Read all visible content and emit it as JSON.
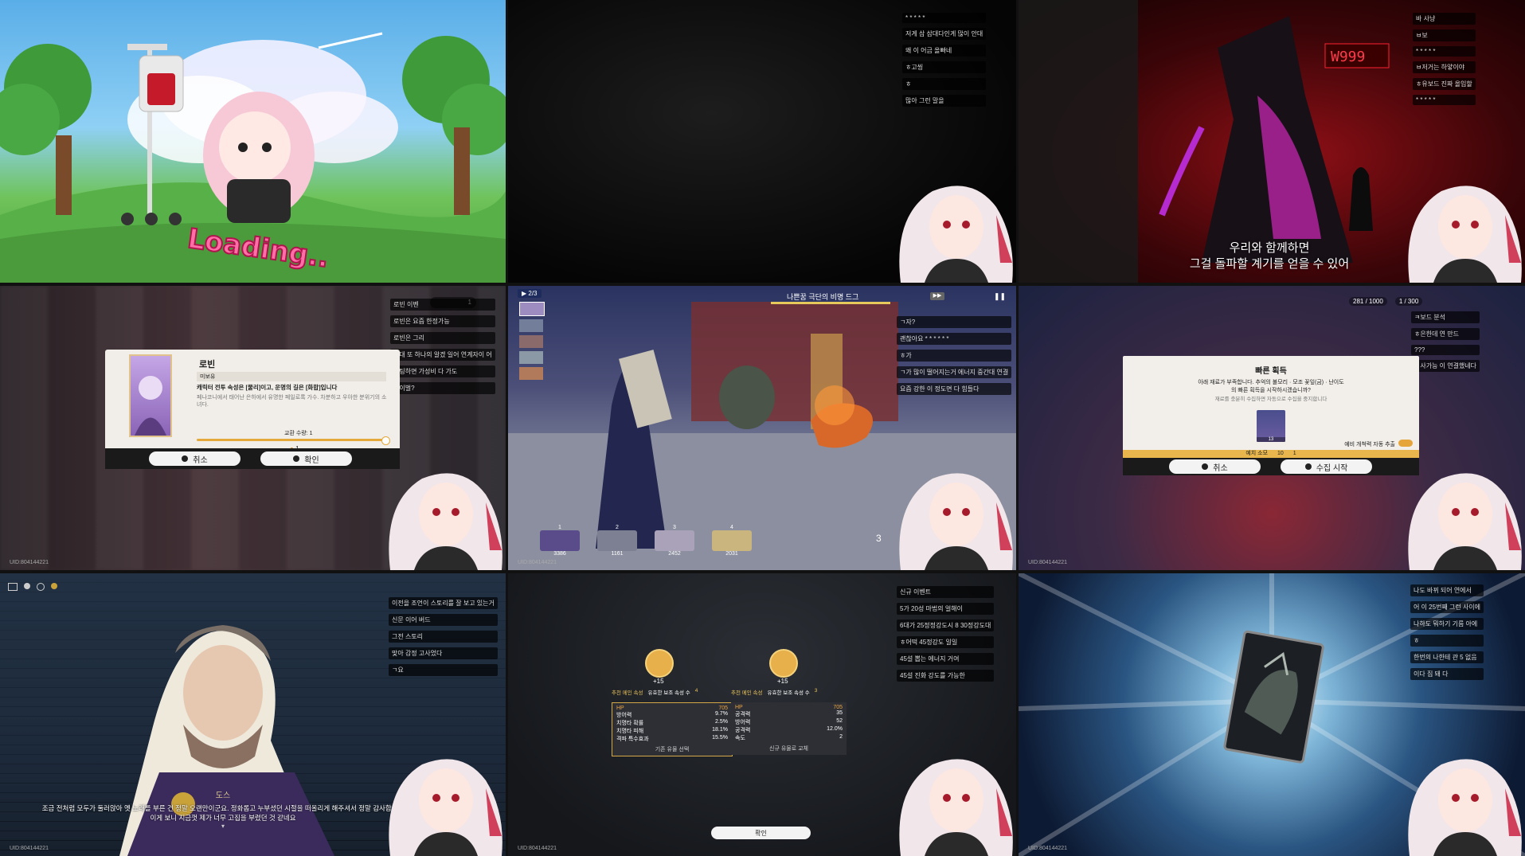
{
  "uid": "UID:804144221",
  "p1": {
    "loading": "Loading.."
  },
  "p2": {
    "chat": [
      "* * * * *",
      "저게 삼 삼대다인게 많이 안대",
      "왜 이 어금 올빠네",
      "ㅎ고씽",
      "ㅎ",
      "많아 그런 말을"
    ]
  },
  "p3": {
    "chat": [
      "바 사냥",
      "ㅂ보",
      "* * * * *",
      "ㅂ저거는 하얗이야",
      "ㅎ유보드 진짜 올입할",
      "* * * * *"
    ],
    "subtitle1": "우리와 함께하면",
    "subtitle2": "그걸 돌파할 계기를 얻을 수 있어",
    "counter": "W999"
  },
  "p4": {
    "chat": [
      "로빈 이벤",
      "로빈은 요즘 한정가능",
      "로빈은 그리",
      "그대 또 하나의 알겠 일어 연계자이 어",
      "셋팅하면 가성비 다 가도",
      "라이벌?"
    ],
    "name": "로빈",
    "tag": "미보유",
    "desc1": "캐릭터 전투 속성은 [물리]이고, 운명의 길은 [화합]입니다",
    "desc2": "페나코니에서 태어난 은하에서 유명한 페일로록 가수. 차분하고 우아한 분위기의 소녀다.",
    "exchange": "교환 수량: 1",
    "count": "1",
    "cancel": "취소",
    "confirm": "확인",
    "top_count": "1"
  },
  "p5": {
    "wave": "2/3",
    "boss": "나쁜꿈 극단의 비명 드그",
    "chat": [
      "ㄱ자?",
      "괜찮아요 * * * * * *",
      "ㅎ가",
      "ㄱ가 많이 떨어지는거 에너지 중간대 연결",
      "요즘 강한 이 정도면 다 힘들다"
    ],
    "hp": [
      "3386",
      "1161",
      "2452",
      "2031"
    ],
    "slots": [
      "1",
      "2",
      "3",
      "4"
    ],
    "wave_counter": "3"
  },
  "p6": {
    "currency1": "281 / 1000",
    "currency2": "1 / 300",
    "chat": [
      "ㅋ보드 분석",
      "ㅎ은한데 연 만드",
      "???",
      "ㅋ사가능 이 연결했네다"
    ],
    "title": "빠른 획득",
    "line1": "아래 재료가 부족합니다. 추억의 불모리 · 모조 꽃잎(금) · 난이도",
    "line2": "의 빠른 획득을 시작하시겠습니까?",
    "line3": "재료를 충분히 수집하면 자동으로 수집을 중지합니다",
    "item_count": "13",
    "auto_label": "예비 개척력 자동 추출",
    "cost_label": "예치 소모",
    "cost1": "10",
    "cost2": "1",
    "cancel": "취소",
    "start": "수집 시작"
  },
  "p7": {
    "chat": [
      "이전을 조언이 스토리를 잘 보고 있는거",
      "신문 이어 버드",
      "그전 스토리",
      "맞아 감정 고사었다",
      "ㄱ요"
    ],
    "speaker": "도스",
    "line1": "조금 전처럼 모두가 둘러앉아 옛 노래를 부른 건 정말 오랜만이군요. 정화롭고 누부셨던 시절을 떠올리게 해주셔서 정말 감사합니다",
    "line2": "이게 보니 지금껏 제가 너무 고집을 부렸던 것 같네요"
  },
  "p8": {
    "chat": [
      "신규 이벤트",
      "5가 20성 마법의 얼해이",
      "6대가 25정정강도시 8 30정강도대",
      "ㅎ어떡 45정강도 일일",
      "45설 뽑는 에너지 거여",
      "45설 진화 강도를 가능한"
    ],
    "left": {
      "plus": "+15",
      "h1": "추천 메인 속성",
      "h2": "유효한 보조 속성 수",
      "n": "4",
      "main": "HP",
      "main_val": "705",
      "stats": [
        [
          "방어력",
          "9.7%"
        ],
        [
          "치명타 확률",
          "2.5%"
        ],
        [
          "치명타 피해",
          "18.1%"
        ],
        [
          "격파 특수효과",
          "15.5%"
        ]
      ],
      "action": "기존 유물 선택"
    },
    "right": {
      "plus": "+15",
      "h1": "추천 메인 속성",
      "h2": "유효한 보조 속성 수",
      "n": "3",
      "main": "HP",
      "main_val": "705",
      "stats": [
        [
          "공격력",
          "35"
        ],
        [
          "방어력",
          "52"
        ],
        [
          "공격력",
          "12.0%"
        ],
        [
          "속도",
          "2"
        ]
      ],
      "action": "신규 유물로 교체"
    },
    "confirm": "확인"
  },
  "p9": {
    "chat": [
      "나도 바뀌 되어 연에서",
      "어 이 25번째 그런 사이에",
      "나하도 뭐하기 기름 아에",
      "ㅎ",
      "한번의 나한테 관 5 없음",
      "이다 집 돼 다"
    ]
  }
}
